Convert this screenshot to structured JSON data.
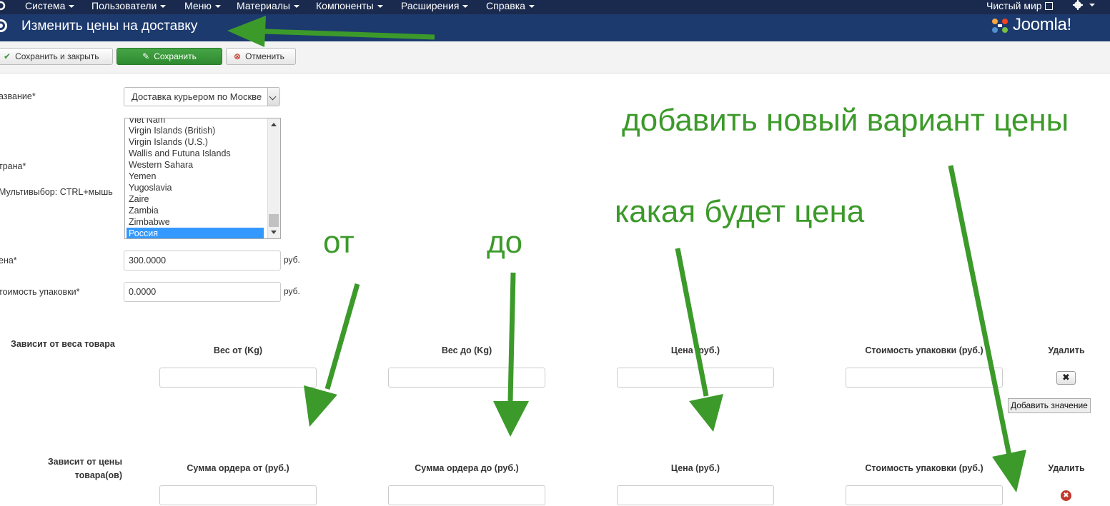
{
  "navbar": {
    "items": [
      {
        "label": "Система"
      },
      {
        "label": "Пользователи"
      },
      {
        "label": "Меню"
      },
      {
        "label": "Материалы"
      },
      {
        "label": "Компоненты"
      },
      {
        "label": "Расширения"
      },
      {
        "label": "Справка"
      }
    ],
    "site_link": "Чистый мир"
  },
  "header": {
    "title": "Изменить цены на доставку",
    "brand": "Joomla!"
  },
  "toolbar": {
    "save_close": "Сохранить и закрыть",
    "save": "Сохранить",
    "cancel": "Отменить"
  },
  "form": {
    "name_label": "азвание*",
    "name_value": "Доставка курьером по Москве",
    "country_label": "трана*",
    "multiselect_hint": "Мультивыбор: CTRL+мышь",
    "countries": [
      "Viet Nam",
      "Virgin Islands (British)",
      "Virgin Islands (U.S.)",
      "Wallis and Futuna Islands",
      "Western Sahara",
      "Yemen",
      "Yugoslavia",
      "Zaire",
      "Zambia",
      "Zimbabwe",
      "Россия"
    ],
    "selected_country": "Россия",
    "price_label": "ена*",
    "price_value": "300.0000",
    "price_unit": "руб.",
    "pack_label": "тоимость упаковки*",
    "pack_value": "0.0000",
    "pack_unit": "руб."
  },
  "weight_section": {
    "title": "Зависит от веса товара",
    "columns": [
      "Вес от (Kg)",
      "Вес до (Kg)",
      "Цена (руб.)",
      "Стоимость упаковки (руб.)",
      "Удалить"
    ],
    "delete_glyph": "✖",
    "add_button": "Добавить значение"
  },
  "order_section": {
    "title_line1": "Зависит от цены",
    "title_line2": "товара(ов)",
    "columns": [
      "Сумма ордера от (руб.)",
      "Сумма ордера до (руб.)",
      "Цена (руб.)",
      "Стоимость упаковки (руб.)",
      "Удалить"
    ],
    "delete_glyph": "✖"
  },
  "annotations": {
    "add_new": "добавить новый вариант цены",
    "what_price": "какая будет цена",
    "from": "от",
    "to": "до"
  },
  "colors": {
    "navbar": "#1a2a4e",
    "header": "#1c3a6e",
    "success": "#3a973a",
    "annotation": "#3c9a2a"
  }
}
